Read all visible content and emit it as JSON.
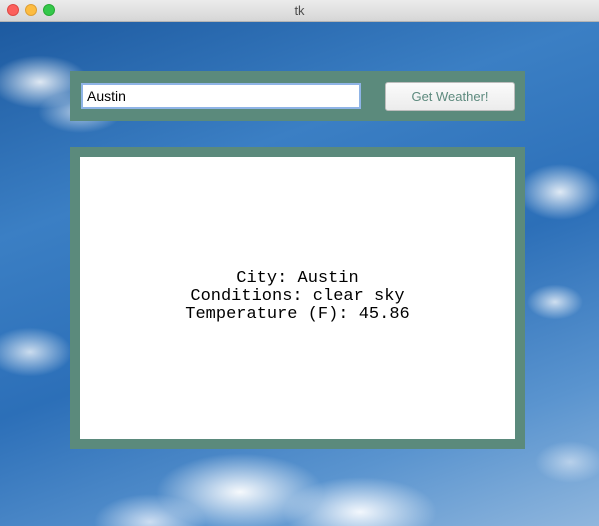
{
  "window": {
    "title": "tk"
  },
  "form": {
    "city_value": "Austin",
    "button_label": "Get Weather!"
  },
  "result": {
    "city_line": "City: Austin",
    "conditions_line": "Conditions: clear sky",
    "temperature_line": "Temperature (F): 45.86"
  },
  "colors": {
    "frame": "#5b8a7c",
    "button_text": "#5d8a7e",
    "input_focus_border": "#8fb4e6"
  }
}
